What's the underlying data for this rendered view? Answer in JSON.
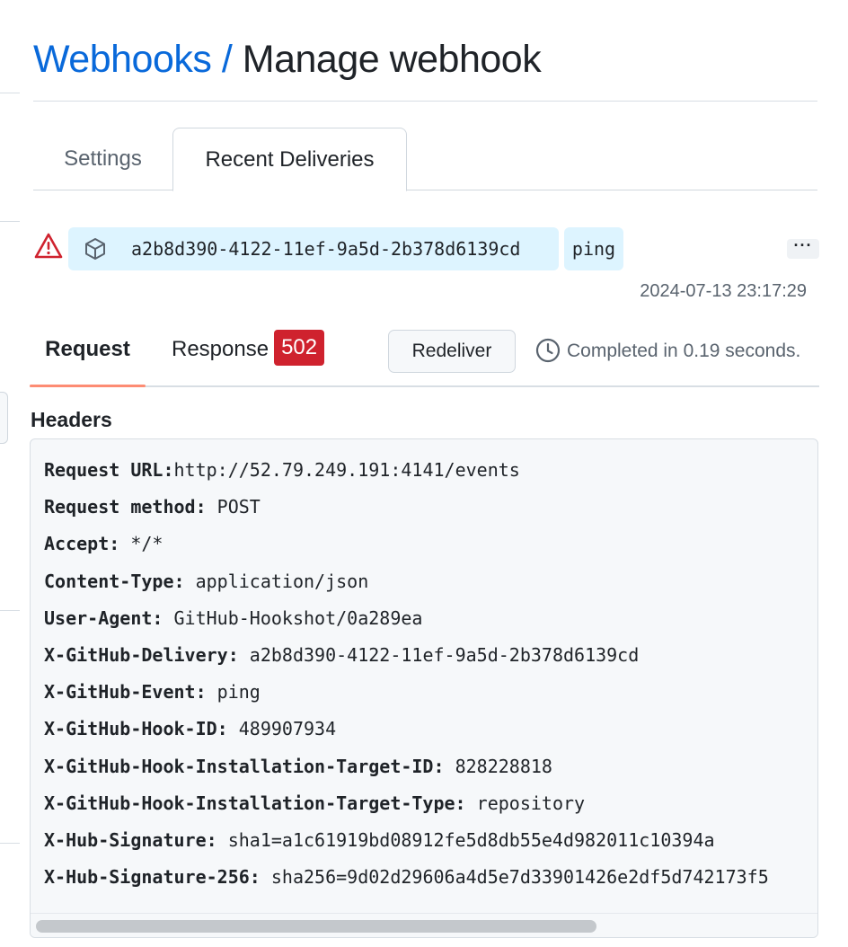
{
  "breadcrumb": {
    "parent": "Webhooks",
    "separator": "/",
    "current": "Manage webhook"
  },
  "tabs": [
    {
      "label": "Settings",
      "active": false
    },
    {
      "label": "Recent Deliveries",
      "active": true
    }
  ],
  "delivery": {
    "status_icon": "alert-icon",
    "type_icon": "package-icon",
    "id": "a2b8d390-4122-11ef-9a5d-2b378d6139cd",
    "event": "ping",
    "more_label": "···",
    "timestamp": "2024-07-13 23:17:29"
  },
  "detail_tabs": {
    "request_label": "Request",
    "response_label": "Response",
    "response_code": "502",
    "redeliver_label": "Redeliver",
    "completed_text": "Completed in 0.19 seconds."
  },
  "headers": {
    "title": "Headers",
    "lines": [
      {
        "key": "Request URL:",
        "value": "http://52.79.249.191:4141/events"
      },
      {
        "key": "Request method:",
        "value": " POST"
      },
      {
        "key": "Accept:",
        "value": " */*"
      },
      {
        "key": "Content-Type:",
        "value": " application/json"
      },
      {
        "key": "User-Agent:",
        "value": " GitHub-Hookshot/0a289ea"
      },
      {
        "key": "X-GitHub-Delivery:",
        "value": " a2b8d390-4122-11ef-9a5d-2b378d6139cd"
      },
      {
        "key": "X-GitHub-Event:",
        "value": " ping"
      },
      {
        "key": "X-GitHub-Hook-ID:",
        "value": " 489907934"
      },
      {
        "key": "X-GitHub-Hook-Installation-Target-ID:",
        "value": " 828228818"
      },
      {
        "key": "X-GitHub-Hook-Installation-Target-Type:",
        "value": " repository"
      },
      {
        "key": "X-Hub-Signature:",
        "value": " sha1=a1c61919bd08912fe5d8db55e4d982011c10394a"
      },
      {
        "key": "X-Hub-Signature-256:",
        "value": " sha256=9d02d29606a4d5e7d33901426e2df5d742173f5"
      }
    ]
  },
  "colors": {
    "link": "#0969da",
    "chip_bg": "#ddf4ff",
    "danger": "#cf222e",
    "active_underline": "#fd8c73"
  }
}
